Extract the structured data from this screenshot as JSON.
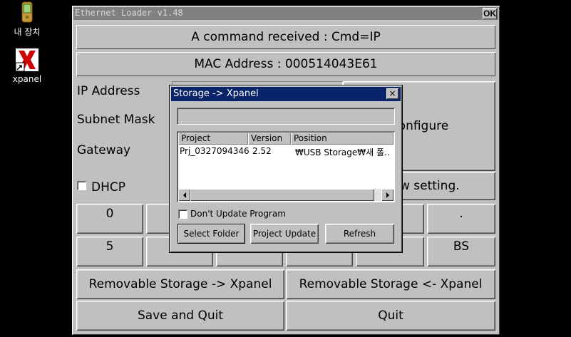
{
  "desktop": {
    "icons": [
      {
        "label": "내 장치",
        "icon": "pda-device-icon"
      },
      {
        "label": "xpanel",
        "icon": "xpanel-app-icon"
      }
    ]
  },
  "window": {
    "title": "Ethernet Loader v1.48",
    "ok_label": "OK",
    "status": "A command received : Cmd=IP",
    "mac": "MAC Address : 000514043E61",
    "ip_label": "IP Address",
    "subnet_label": "Subnet Mask",
    "gateway_label": "Gateway",
    "configure_label": "Configure",
    "dhcp_label": "DHCP",
    "dhcp_checked": false,
    "view_setting_label": "w setting.",
    "keypad": {
      "key_0": "0",
      "key_5": "5",
      "key_dot": ".",
      "key_bs": "BS"
    },
    "storage_to_xpanel": "Removable Storage -> Xpanel",
    "xpanel_to_storage": "Removable Storage <- Xpanel",
    "save_quit": "Save and Quit",
    "quit": "Quit"
  },
  "dialog": {
    "title": "Storage -> Xpanel",
    "close_label": "×",
    "columns": [
      "Project",
      "Version",
      "Position"
    ],
    "rows": [
      {
        "project": "Prj_0327094346",
        "version": "2.52",
        "position": "₩USB Storage₩새 폴..."
      }
    ],
    "dont_update_label": "Don't Update Program",
    "dont_update_checked": false,
    "select_folder_label": "Select Folder",
    "project_update_label": "Project Update",
    "refresh_label": "Refresh"
  }
}
